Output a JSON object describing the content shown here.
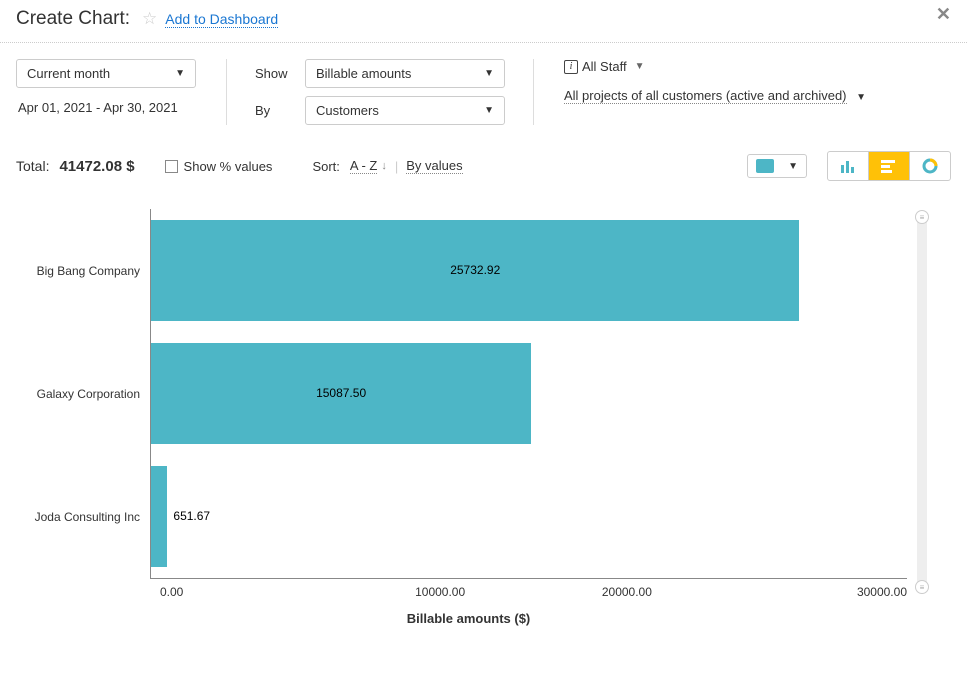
{
  "header": {
    "title": "Create Chart:",
    "add_link": "Add to Dashboard"
  },
  "filters": {
    "period_select": "Current month",
    "date_range": "Apr 01, 2021  -  Apr 30, 2021",
    "show_label": "Show",
    "show_value": "Billable amounts",
    "by_label": "By",
    "by_value": "Customers",
    "staff": "All Staff",
    "projects": "All projects of all customers (active and archived)"
  },
  "controls": {
    "total_label": "Total:",
    "total_value": "41472.08 $",
    "show_percent": "Show % values",
    "sort_label": "Sort:",
    "sort_az": "A - Z",
    "sort_values": "By values"
  },
  "chart_data": {
    "type": "bar",
    "orientation": "horizontal",
    "categories": [
      "Big Bang Company",
      "Galaxy Corporation",
      "Joda Consulting Inc"
    ],
    "values": [
      25732.92,
      15087.5,
      651.67
    ],
    "value_labels": [
      "25732.92",
      "15087.50",
      "651.67"
    ],
    "xlabel": "Billable amounts ($)",
    "ylabel": "",
    "xlim": [
      0,
      30000
    ],
    "xticks": [
      "0.00",
      "10000.00",
      "20000.00",
      "30000.00"
    ],
    "color": "#4db6c6"
  }
}
